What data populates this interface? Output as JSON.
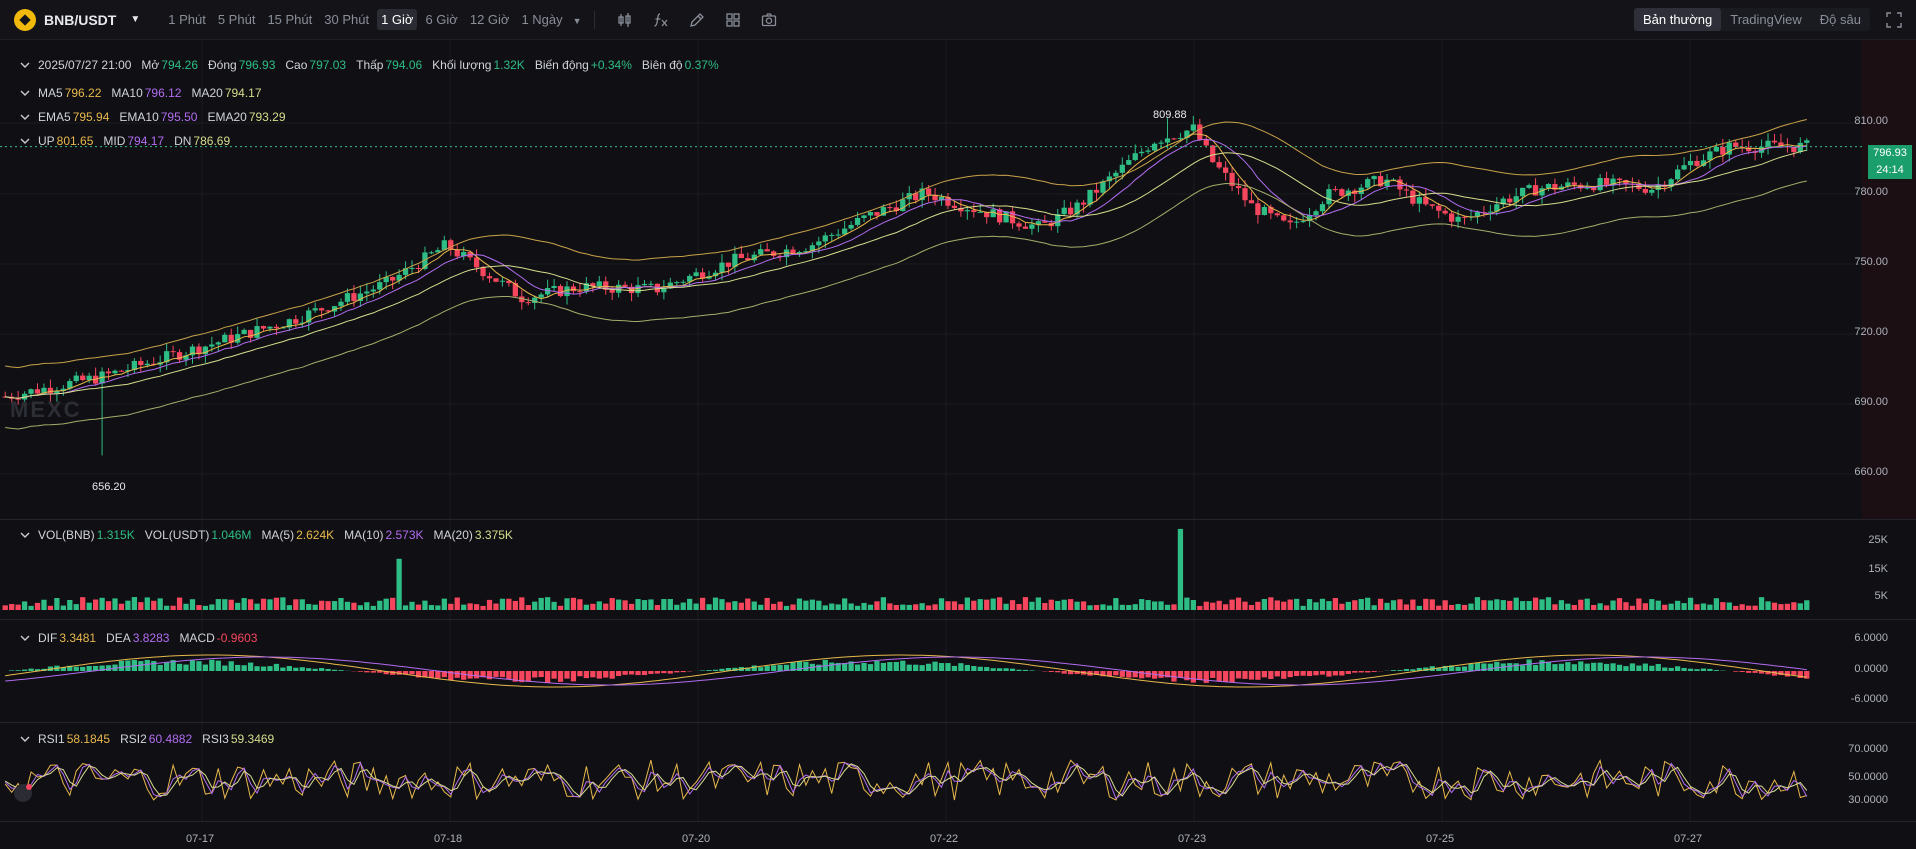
{
  "toolbar": {
    "symbol": "BNB/USDT",
    "intervals": [
      "1 Phút",
      "5 Phút",
      "15 Phút",
      "30 Phút",
      "1 Giờ",
      "6 Giờ",
      "12 Giờ",
      "1 Ngày"
    ],
    "active_interval": "1 Giờ",
    "tools": [
      "candles-icon",
      "indicator-fx-icon",
      "pencil-icon",
      "layout-icon",
      "camera-icon"
    ],
    "views": [
      "Bản thường",
      "TradingView",
      "Độ sâu"
    ],
    "active_view": "Bản thường"
  },
  "ohlc": {
    "time": "2025/07/27 21:00",
    "open_label": "Mở",
    "open": "794.26",
    "close_label": "Đóng",
    "close": "796.93",
    "high_label": "Cao",
    "high": "797.03",
    "low_label": "Thấp",
    "low": "794.06",
    "volume_label": "Khối lượng",
    "volume": "1.32K",
    "change_label": "Biến động",
    "change": "+0.34%",
    "amplitude_label": "Biên độ",
    "amplitude": "0.37%"
  },
  "ma": {
    "ma5_label": "MA5",
    "ma5": "796.22",
    "ma10_label": "MA10",
    "ma10": "796.12",
    "ma20_label": "MA20",
    "ma20": "794.17"
  },
  "ema": {
    "ema5_label": "EMA5",
    "ema5": "795.94",
    "ema10_label": "EMA10",
    "ema10": "795.50",
    "ema20_label": "EMA20",
    "ema20": "793.29"
  },
  "boll": {
    "up_label": "UP",
    "up": "801.65",
    "mid_label": "MID",
    "mid": "794.17",
    "dn_label": "DN",
    "dn": "786.69"
  },
  "vol": {
    "vol_bnb_label": "VOL(BNB)",
    "vol_bnb": "1.315K",
    "vol_usdt_label": "VOL(USDT)",
    "vol_usdt": "1.046M",
    "ma5_label": "MA(5)",
    "ma5": "2.624K",
    "ma10_label": "MA(10)",
    "ma10": "2.573K",
    "ma20_label": "MA(20)",
    "ma20": "3.375K"
  },
  "macd": {
    "dif_label": "DIF",
    "dif": "3.3481",
    "dea_label": "DEA",
    "dea": "3.8283",
    "macd_label": "MACD",
    "macd": "-0.9603"
  },
  "rsi": {
    "rsi1_label": "RSI1",
    "rsi1": "58.1845",
    "rsi2_label": "RSI2",
    "rsi2": "60.4882",
    "rsi3_label": "RSI3",
    "rsi3": "59.3469"
  },
  "price_axis": [
    "810.00",
    "780.00",
    "750.00",
    "720.00",
    "690.00",
    "660.00"
  ],
  "volume_axis": [
    "25K",
    "15K",
    "5K"
  ],
  "macd_axis": [
    "6.0000",
    "0.0000",
    "-6.0000"
  ],
  "rsi_axis": [
    "70.0000",
    "50.0000",
    "30.0000"
  ],
  "time_axis": [
    "07-17",
    "07-18",
    "07-20",
    "07-22",
    "07-23",
    "07-25",
    "07-27"
  ],
  "last_price": "796.93",
  "countdown": "24:14",
  "high_marker": "809.88",
  "low_marker": "656.20",
  "watermark": "MEXC",
  "colors": {
    "up": "#2ebd85",
    "down": "#f6465d",
    "ma5": "#e8b84c",
    "ma10": "#b26cf0",
    "ma20": "#d7dc8c",
    "background": "#101014"
  },
  "chart_data": {
    "type": "candlestick",
    "interval": "1 Giờ",
    "price_range": [
      645,
      825
    ],
    "x": [
      "07-17",
      "07-18",
      "07-20",
      "07-22",
      "07-23",
      "07-25",
      "07-27"
    ],
    "close_path": [
      [
        0,
        683
      ],
      [
        0.05,
        692
      ],
      [
        0.1,
        705
      ],
      [
        0.15,
        718
      ],
      [
        0.2,
        735
      ],
      [
        0.23,
        752
      ],
      [
        0.25,
        740
      ],
      [
        0.27,
        728
      ],
      [
        0.3,
        733
      ],
      [
        0.34,
        732
      ],
      [
        0.38,
        745
      ],
      [
        0.42,
        752
      ],
      [
        0.45,
        765
      ],
      [
        0.48,
        776
      ],
      [
        0.5,
        770
      ],
      [
        0.52,
        765
      ],
      [
        0.54,
        760
      ],
      [
        0.56,
        770
      ],
      [
        0.58,
        785
      ],
      [
        0.6,
        800
      ],
      [
        0.62,
        805
      ],
      [
        0.63,
        790
      ],
      [
        0.65,
        770
      ],
      [
        0.67,
        760
      ],
      [
        0.69,
        775
      ],
      [
        0.72,
        782
      ],
      [
        0.74,
        770
      ],
      [
        0.76,
        763
      ],
      [
        0.78,
        772
      ],
      [
        0.8,
        778
      ],
      [
        0.83,
        780
      ],
      [
        0.86,
        778
      ],
      [
        0.88,
        790
      ],
      [
        0.9,
        797
      ],
      [
        0.94,
        797
      ]
    ],
    "high": 809.88,
    "low": 656.2,
    "last_close": 796.93
  }
}
